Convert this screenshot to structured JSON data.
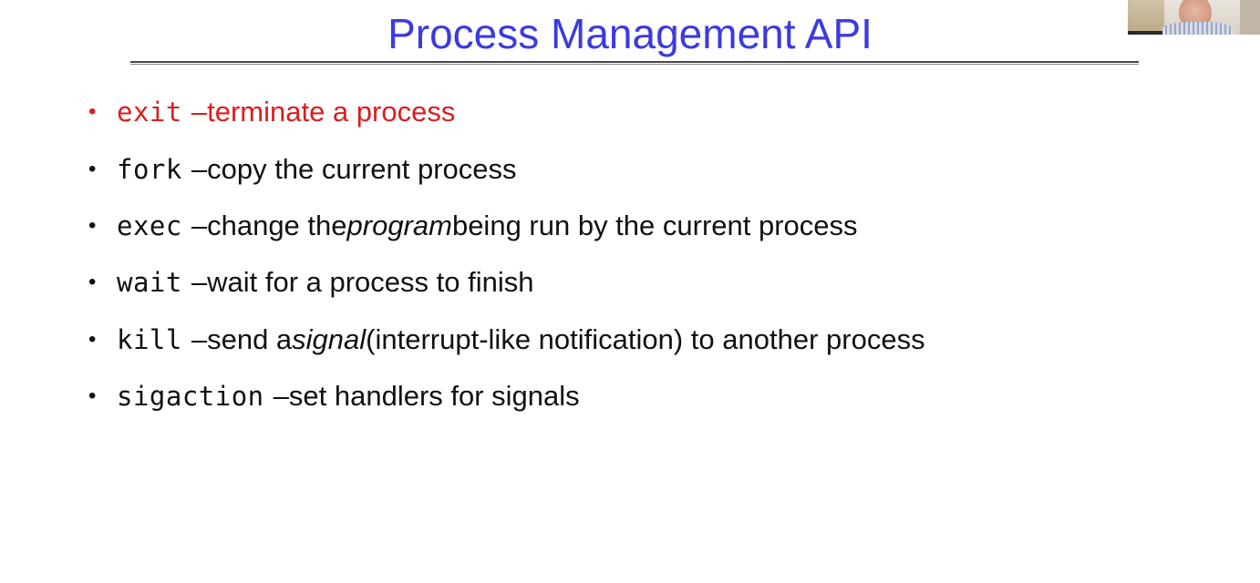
{
  "slide": {
    "title": "Process Management API",
    "items": [
      {
        "cmd": "exit",
        "sep": "–",
        "text_before": " terminate a process",
        "emph": "",
        "text_after": "",
        "active": true
      },
      {
        "cmd": "fork",
        "sep": "–",
        "text_before": " copy the current process",
        "emph": "",
        "text_after": "",
        "active": false
      },
      {
        "cmd": "exec",
        "sep": "–",
        "text_before": " change the ",
        "emph": "program",
        "text_after": " being run by the current process",
        "active": false
      },
      {
        "cmd": "wait",
        "sep": "–",
        "text_before": " wait for a process to finish",
        "emph": "",
        "text_after": "",
        "active": false
      },
      {
        "cmd": "kill",
        "sep": "–",
        "text_before": " send a ",
        "emph": "signal",
        "text_after": " (interrupt-like notification) to another process",
        "active": false
      },
      {
        "cmd": "sigaction",
        "sep": "–",
        "text_before": " set handlers for signals",
        "emph": "",
        "text_after": "",
        "active": false
      }
    ],
    "bullet_glyph": "•",
    "colors": {
      "title": "#3b3bdf",
      "active_item": "#d81e1e",
      "body_text": "#111111",
      "rule": "#4a4a4a"
    }
  }
}
